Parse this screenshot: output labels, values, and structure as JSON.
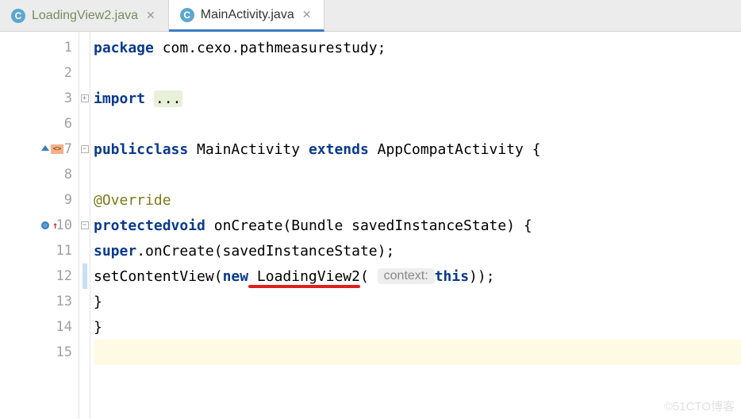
{
  "tabs": [
    {
      "label": "LoadingView2.java",
      "icon": "C",
      "active": false
    },
    {
      "label": "MainActivity.java",
      "icon": "C",
      "active": true
    }
  ],
  "gutter_lines": [
    "1",
    "2",
    "3",
    "6",
    "7",
    "8",
    "9",
    "10",
    "11",
    "12",
    "13",
    "14",
    "15"
  ],
  "code": {
    "package_kw": "package",
    "package_name": " com.cexo.pathmeasurestudy;",
    "import_kw": "import ",
    "import_folded": "...",
    "public_kw": "public",
    "class_kw": "class",
    "class_name": " MainActivity ",
    "extends_kw": "extends",
    "super_name": " AppCompatActivity {",
    "override": "@Override",
    "protected_kw": "protected",
    "void_kw": "void",
    "method_name": " onCreate(Bundle savedInstanceState) {",
    "super_kw": "super",
    "super_call": ".onCreate(savedInstanceState);",
    "setcontent": "setContentView(",
    "new_kw": "new",
    "loadingview": " LoadingView2",
    "paren_open": "( ",
    "hint_context": "context:",
    "this_kw": "this",
    "close_call": "));",
    "brace1": "}",
    "brace2": "}"
  },
  "watermark": "©51CTO博客"
}
